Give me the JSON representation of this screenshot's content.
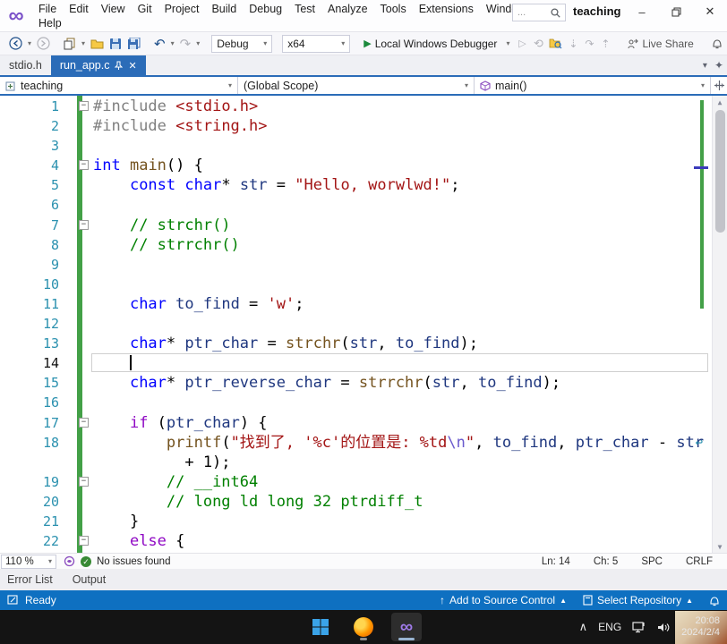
{
  "window": {
    "title": "teaching",
    "search_hint": "...",
    "minimize": "–",
    "close": "✕"
  },
  "menu": {
    "row1": [
      "File",
      "Edit",
      "View",
      "Git",
      "Project",
      "Build",
      "Debug",
      "Test",
      "Analyze",
      "Tools",
      "Extensions",
      "Window"
    ],
    "row2": [
      "Help"
    ]
  },
  "toolbar": {
    "back": "⟵",
    "forward": "⟶",
    "undo": "↶",
    "redo": "↷",
    "config": "Debug",
    "platform": "x64",
    "run_label": "Local Windows Debugger",
    "live_share_label": "Live Share"
  },
  "tabs": [
    {
      "label": "stdio.h",
      "active": false
    },
    {
      "label": "run_app.c",
      "active": true
    }
  ],
  "navbar": {
    "project": "teaching",
    "scope": "(Global Scope)",
    "member": "main()"
  },
  "editor": {
    "palette": {
      "keyword": "#0000FF",
      "control": "#8F08C4",
      "function": "#74531F",
      "variable": "#1F377F",
      "string": "#A31515",
      "escape": "#6A5ACD",
      "comment": "#008000",
      "preprocessor": "#808080",
      "line_numbers": "#2B91AF",
      "change_bar": "#43A047"
    },
    "caret": {
      "line": 14,
      "column": 5
    },
    "lines": [
      {
        "n": 1,
        "fold": true,
        "tokens": [
          [
            "pre",
            "#include"
          ],
          [
            "pl",
            " "
          ],
          [
            "str",
            "<stdio.h>"
          ]
        ]
      },
      {
        "n": 2,
        "tokens": [
          [
            "pre",
            "#include"
          ],
          [
            "pl",
            " "
          ],
          [
            "str",
            "<string.h>"
          ]
        ]
      },
      {
        "n": 3,
        "tokens": []
      },
      {
        "n": 4,
        "fold": true,
        "tokens": [
          [
            "kw",
            "int"
          ],
          [
            "pl",
            " "
          ],
          [
            "fn",
            "main"
          ],
          [
            "pl",
            "() {"
          ]
        ]
      },
      {
        "n": 5,
        "tokens": [
          [
            "pl",
            "    "
          ],
          [
            "kw",
            "const"
          ],
          [
            "pl",
            " "
          ],
          [
            "kw",
            "char"
          ],
          [
            "pl",
            "* "
          ],
          [
            "var",
            "str"
          ],
          [
            "pl",
            " = "
          ],
          [
            "str",
            "\"Hello, worwlwd!\""
          ],
          [
            "pl",
            ";"
          ]
        ]
      },
      {
        "n": 6,
        "tokens": []
      },
      {
        "n": 7,
        "fold": true,
        "tokens": [
          [
            "pl",
            "    "
          ],
          [
            "cmt",
            "// strchr()"
          ]
        ]
      },
      {
        "n": 8,
        "tokens": [
          [
            "pl",
            "    "
          ],
          [
            "cmt",
            "// strrchr()"
          ]
        ]
      },
      {
        "n": 9,
        "tokens": []
      },
      {
        "n": 10,
        "tokens": []
      },
      {
        "n": 11,
        "tokens": [
          [
            "pl",
            "    "
          ],
          [
            "kw",
            "char"
          ],
          [
            "pl",
            " "
          ],
          [
            "var",
            "to_find"
          ],
          [
            "pl",
            " = "
          ],
          [
            "str",
            "'w'"
          ],
          [
            "pl",
            ";"
          ]
        ]
      },
      {
        "n": 12,
        "tokens": []
      },
      {
        "n": 13,
        "tokens": [
          [
            "pl",
            "    "
          ],
          [
            "kw",
            "char"
          ],
          [
            "pl",
            "* "
          ],
          [
            "var",
            "ptr_char"
          ],
          [
            "pl",
            " = "
          ],
          [
            "fn",
            "strchr"
          ],
          [
            "pl",
            "("
          ],
          [
            "var",
            "str"
          ],
          [
            "pl",
            ", "
          ],
          [
            "var",
            "to_find"
          ],
          [
            "pl",
            ");"
          ]
        ]
      },
      {
        "n": 14,
        "current": true,
        "tokens": [
          [
            "pl",
            "    "
          ]
        ]
      },
      {
        "n": 15,
        "tokens": [
          [
            "pl",
            "    "
          ],
          [
            "kw",
            "char"
          ],
          [
            "pl",
            "* "
          ],
          [
            "var",
            "ptr_reverse_char"
          ],
          [
            "pl",
            " = "
          ],
          [
            "fn",
            "strrchr"
          ],
          [
            "pl",
            "("
          ],
          [
            "var",
            "str"
          ],
          [
            "pl",
            ", "
          ],
          [
            "var",
            "to_find"
          ],
          [
            "pl",
            ");"
          ]
        ]
      },
      {
        "n": 16,
        "tokens": []
      },
      {
        "n": 17,
        "fold": true,
        "tokens": [
          [
            "pl",
            "    "
          ],
          [
            "ctrl",
            "if"
          ],
          [
            "pl",
            " ("
          ],
          [
            "var",
            "ptr_char"
          ],
          [
            "pl",
            ") {"
          ]
        ]
      },
      {
        "n": 18,
        "wrap": true,
        "tokens": [
          [
            "pl",
            "        "
          ],
          [
            "fn",
            "printf"
          ],
          [
            "pl",
            "("
          ],
          [
            "str",
            "\"找到了, '%c'的位置是: %td"
          ],
          [
            "esc",
            "\\n"
          ],
          [
            "str",
            "\""
          ],
          [
            "pl",
            ", "
          ],
          [
            "var",
            "to_find"
          ],
          [
            "pl",
            ", "
          ],
          [
            "var",
            "ptr_char"
          ],
          [
            "pl",
            " - "
          ],
          [
            "var",
            "str"
          ]
        ]
      },
      {
        "wrapRow": true,
        "tokens": [
          [
            "pl",
            "          + 1);"
          ]
        ]
      },
      {
        "n": 19,
        "fold": true,
        "tokens": [
          [
            "pl",
            "        "
          ],
          [
            "cmt",
            "// __int64"
          ]
        ]
      },
      {
        "n": 20,
        "tokens": [
          [
            "pl",
            "        "
          ],
          [
            "cmt",
            "// long ld long 32 ptrdiff_t"
          ]
        ]
      },
      {
        "n": 21,
        "tokens": [
          [
            "pl",
            "    }"
          ]
        ]
      },
      {
        "n": 22,
        "fold": true,
        "tokens": [
          [
            "pl",
            "    "
          ],
          [
            "ctrl",
            "else"
          ],
          [
            "pl",
            " {"
          ]
        ]
      }
    ]
  },
  "editor_status": {
    "zoom": "110 %",
    "health": "No issues found",
    "ln": "Ln: 14",
    "ch": "Ch: 5",
    "spaces": "SPC",
    "line_ending": "CRLF"
  },
  "panel_tabs": {
    "items": [
      "Error List",
      "Output"
    ]
  },
  "status_bar": {
    "ready": "Ready",
    "add_to_source_control": "Add to Source Control",
    "select_repository": "Select Repository"
  },
  "taskbar": {
    "lang": "ENG",
    "time": "20:08",
    "date": "2024/2/4"
  },
  "colors": {
    "accent_blue": "#2B6CB8",
    "status_bar_blue": "#0E70C1",
    "run_green": "#1C8A3C",
    "vs_purple": "#7B52C9"
  }
}
